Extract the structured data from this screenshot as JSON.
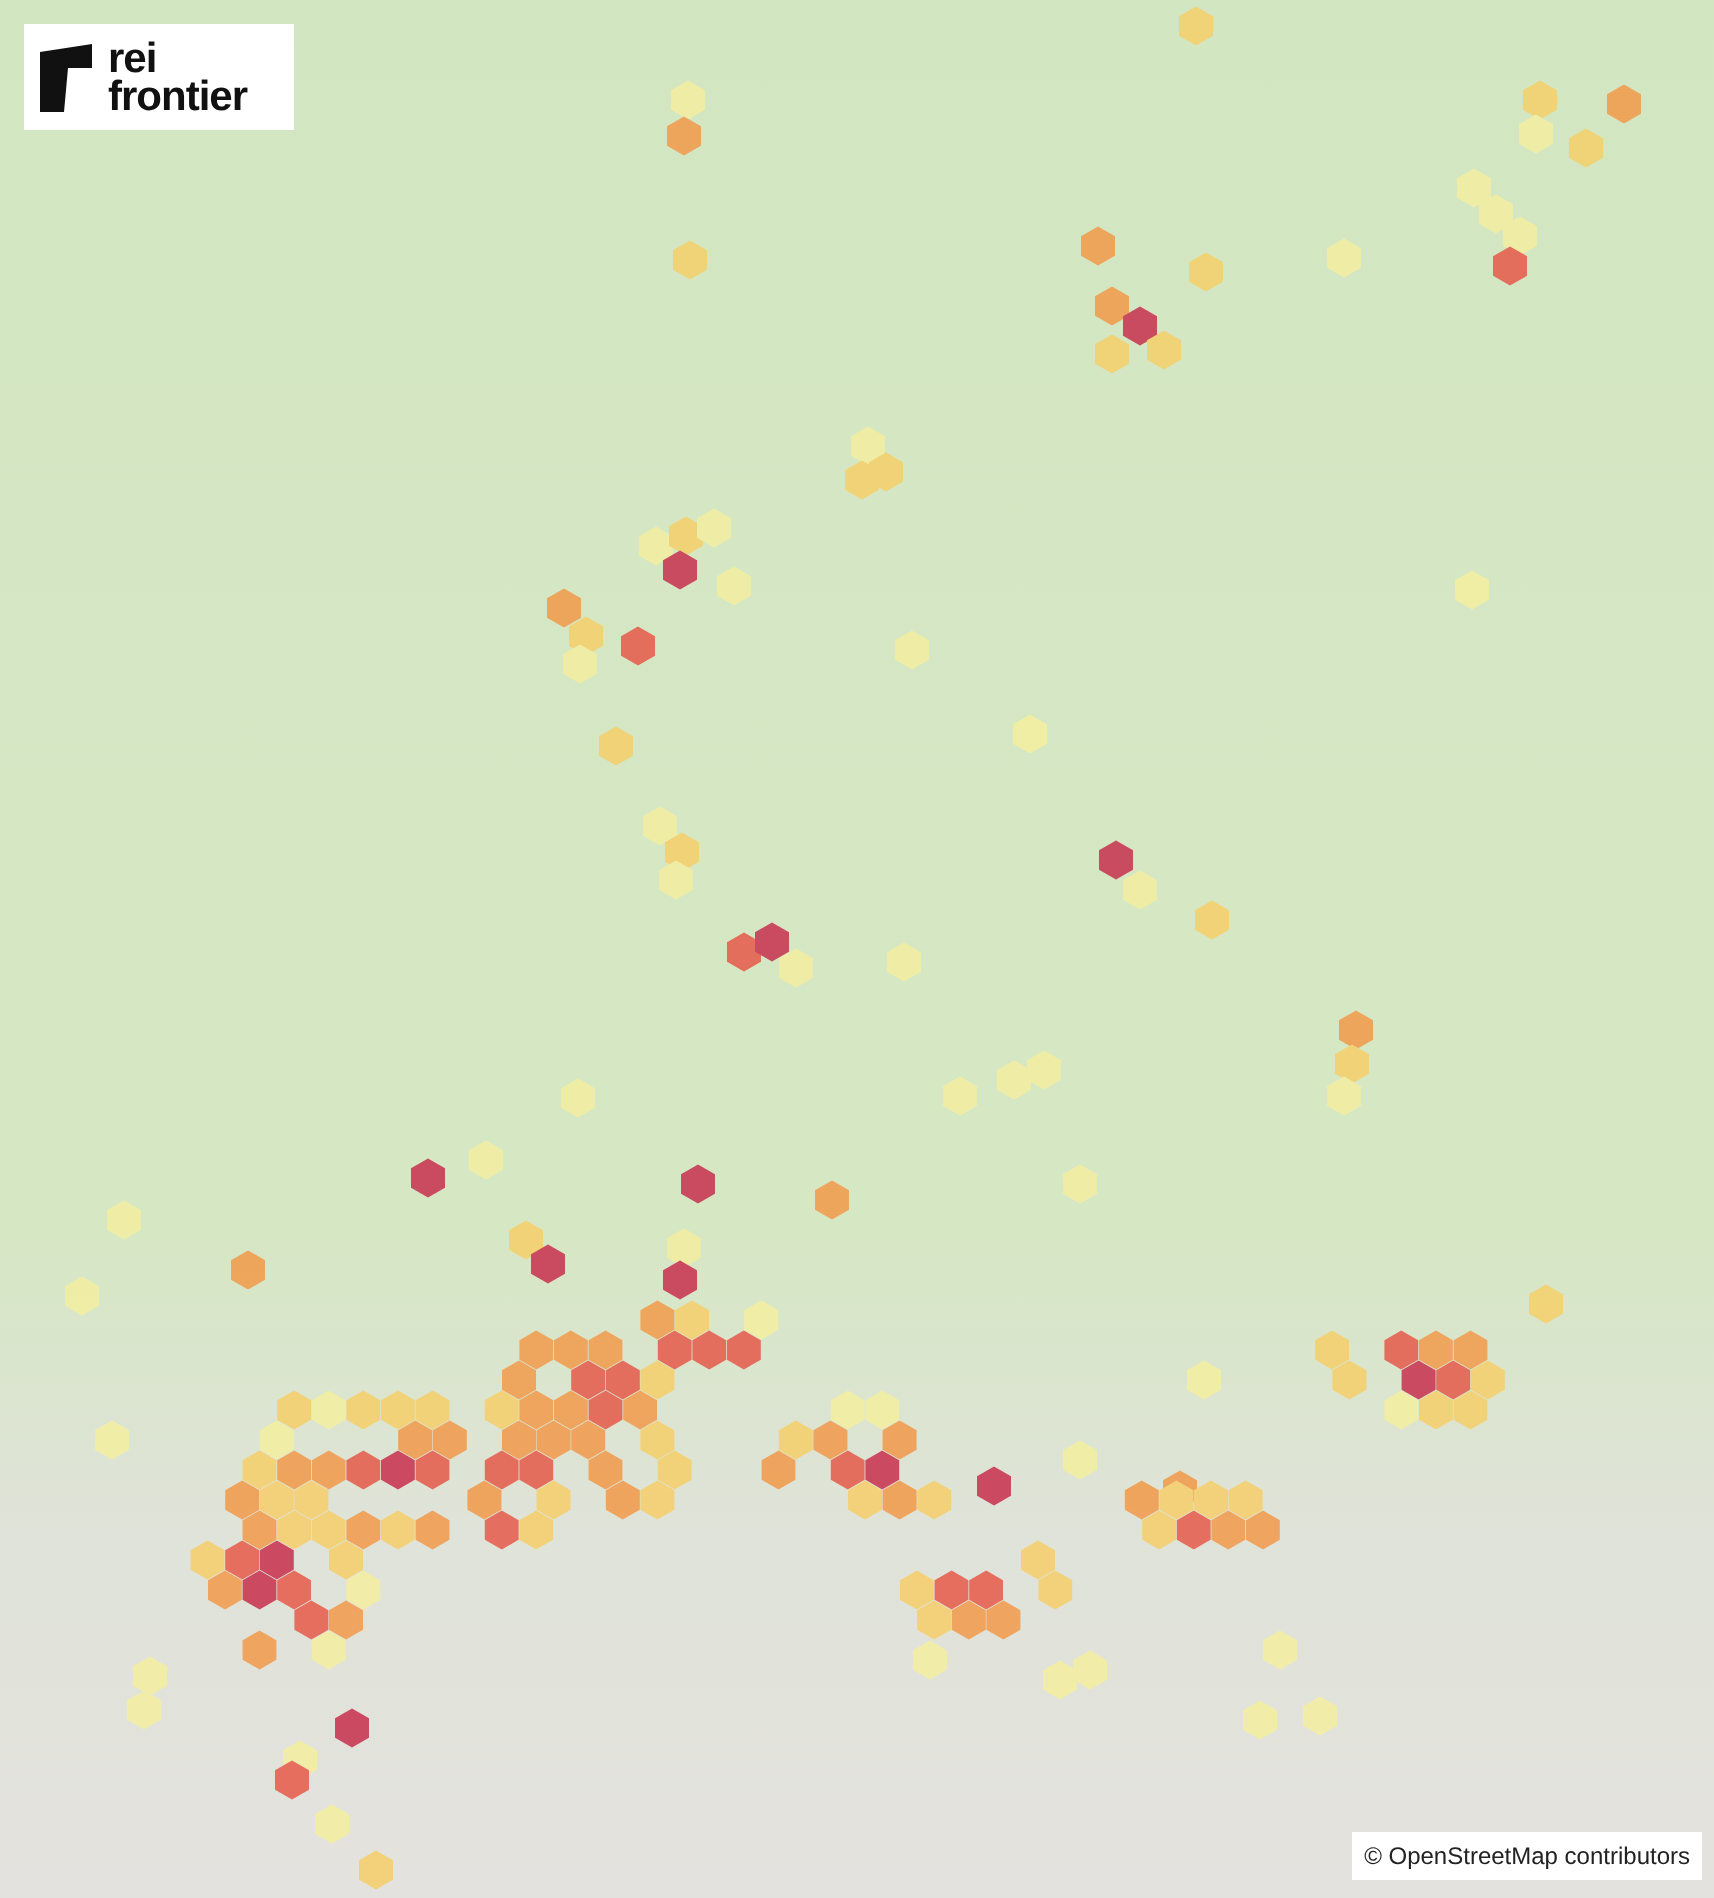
{
  "logo": {
    "lines": [
      "rei",
      "frontier"
    ]
  },
  "attribution": "© OpenStreetMap contributors"
}
